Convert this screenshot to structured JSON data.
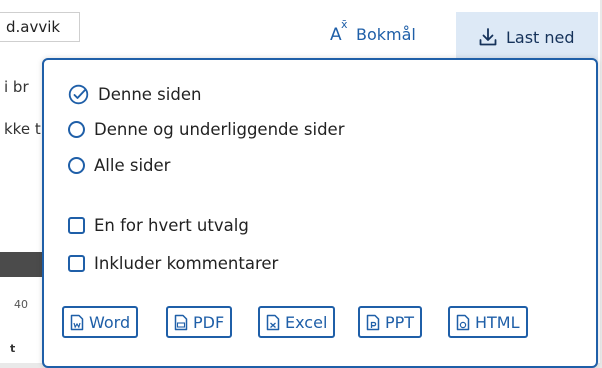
{
  "background": {
    "filter_chip": "d.avvik",
    "partial_text_1": "i br",
    "partial_text_2": "kke t",
    "axis_tick": "40",
    "partial_label": "t"
  },
  "header": {
    "language_label": "Bokmål",
    "language_icon": "translate-icon",
    "download_label": "Last ned",
    "download_icon": "download-icon"
  },
  "panel": {
    "scope_options": [
      {
        "label": "Denne siden",
        "selected": true
      },
      {
        "label": "Denne og underliggende sider",
        "selected": false
      },
      {
        "label": "Alle sider",
        "selected": false
      }
    ],
    "checkboxes": [
      {
        "label": "En for hvert utvalg",
        "checked": false
      },
      {
        "label": "Inkluder kommentarer",
        "checked": false
      }
    ],
    "formats": [
      {
        "label": "Word",
        "icon": "word-file-icon"
      },
      {
        "label": "PDF",
        "icon": "pdf-file-icon"
      },
      {
        "label": "Excel",
        "icon": "excel-file-icon"
      },
      {
        "label": "PPT",
        "icon": "ppt-file-icon"
      },
      {
        "label": "HTML",
        "icon": "html-file-icon"
      }
    ]
  },
  "colors": {
    "accent": "#1f5fa8",
    "download_bg": "#dde9f6"
  }
}
